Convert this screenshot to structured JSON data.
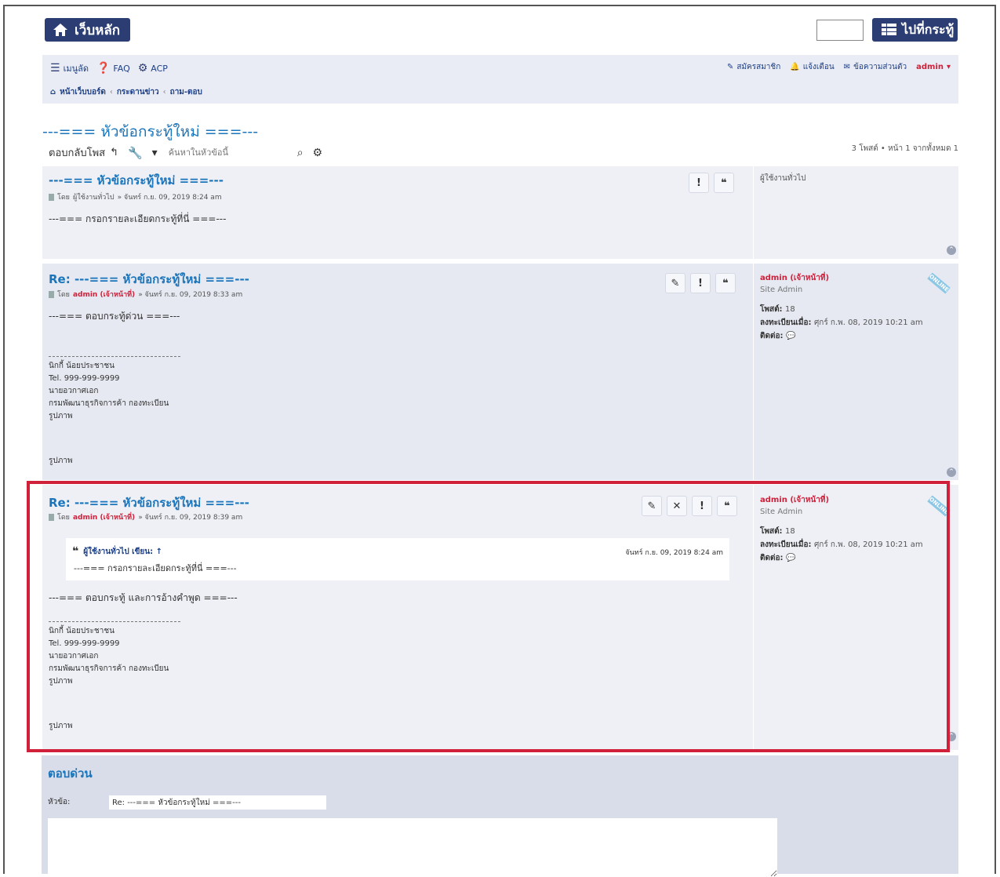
{
  "header": {
    "home_label": "เว็บหลัก",
    "board_label": "ไปที่กระทู้",
    "search_value": ""
  },
  "nav": {
    "menu": "เมนูลัด",
    "faq": "FAQ",
    "acp": "ACP",
    "register": "สมัครสมาชิก",
    "notifications": "แจ้งเตือน",
    "messages": "ข้อความส่วนตัว",
    "user": "admin"
  },
  "breadcrumb": [
    "หน้าเว็บบอร์ด",
    "กระดานข่าว",
    "ถาม-ตอบ"
  ],
  "topic": {
    "title": "---=== หัวข้อกระทู้ใหม่ ===---",
    "reply_label": "ตอบกลับโพส",
    "search_placeholder": "ค้นหาในหัวข้อนี้",
    "pagination": "3 โพสต์ • หน้า 1 จากทั้งหมด 1"
  },
  "posts": [
    {
      "title": "---=== หัวข้อกระทู้ใหม่ ===---",
      "by": "โดย",
      "author": "ผู้ใช้งานทั่วไป",
      "date": "» จันทร์ ก.ย. 09, 2019 8:24 am",
      "body": "---=== กรอกรายละเอียดกระทู้ที่นี่ ===---",
      "profile_name": "ผู้ใช้งานทั่วไป"
    },
    {
      "title": "Re: ---=== หัวข้อกระทู้ใหม่ ===---",
      "by": "โดย",
      "author": "admin (เจ้าหน้าที่)",
      "date": "» จันทร์ ก.ย. 09, 2019 8:33 am",
      "body": "---=== ตอบกระทู้ด่วน ===---",
      "signature": [
        "นิกกี้ น้อยประชาชน",
        "Tel. 999-999-9999",
        "นายอวกาศเอก",
        "กรมพัฒนาธุรกิจการค้า กองทะเบียน",
        "รูปภาพ"
      ],
      "image_label": "รูปภาพ",
      "profile_name": "admin (เจ้าหน้าที่)",
      "profile_rank": "Site Admin",
      "posts_label": "โพสต์:",
      "posts_count": "18",
      "joined_label": "ลงทะเบียนเมื่อ:",
      "joined_date": "ศุกร์ ก.พ. 08, 2019 10:21 am",
      "contact_label": "ติดต่อ:",
      "online": "ONLINE"
    },
    {
      "title": "Re: ---=== หัวข้อกระทู้ใหม่ ===---",
      "by": "โดย",
      "author": "admin (เจ้าหน้าที่)",
      "date": "» จันทร์ ก.ย. 09, 2019 8:39 am",
      "quote_author": "ผู้ใช้งานทั่วไป เขียน: ↑",
      "quote_date": "จันทร์ ก.ย. 09, 2019 8:24 am",
      "quote_text": "---=== กรอกรายละเอียดกระทู้ที่นี่ ===---",
      "body": "---=== ตอบกระทู้ และการอ้างคำพูด ===---",
      "signature": [
        "นิกกี้ น้อยประชาชน",
        "Tel. 999-999-9999",
        "นายอวกาศเอก",
        "กรมพัฒนาธุรกิจการค้า กองทะเบียน",
        "รูปภาพ"
      ],
      "image_label": "รูปภาพ",
      "profile_name": "admin (เจ้าหน้าที่)",
      "profile_rank": "Site Admin",
      "posts_label": "โพสต์:",
      "posts_count": "18",
      "joined_label": "ลงทะเบียนเมื่อ:",
      "joined_date": "ศุกร์ ก.พ. 08, 2019 10:21 am",
      "contact_label": "ติดต่อ:",
      "online": "ONLINE"
    }
  ],
  "quick_reply": {
    "title": "ตอบด่วน",
    "subject_label": "หัวข้อ:",
    "subject_value": "Re: ---=== หัวข้อกระทู้ใหม่ ===---"
  },
  "colors": {
    "accent": "#1b75bb",
    "header_button": "#2b3d73",
    "highlight_border": "#d1203a",
    "admin_name": "#d1203a"
  }
}
